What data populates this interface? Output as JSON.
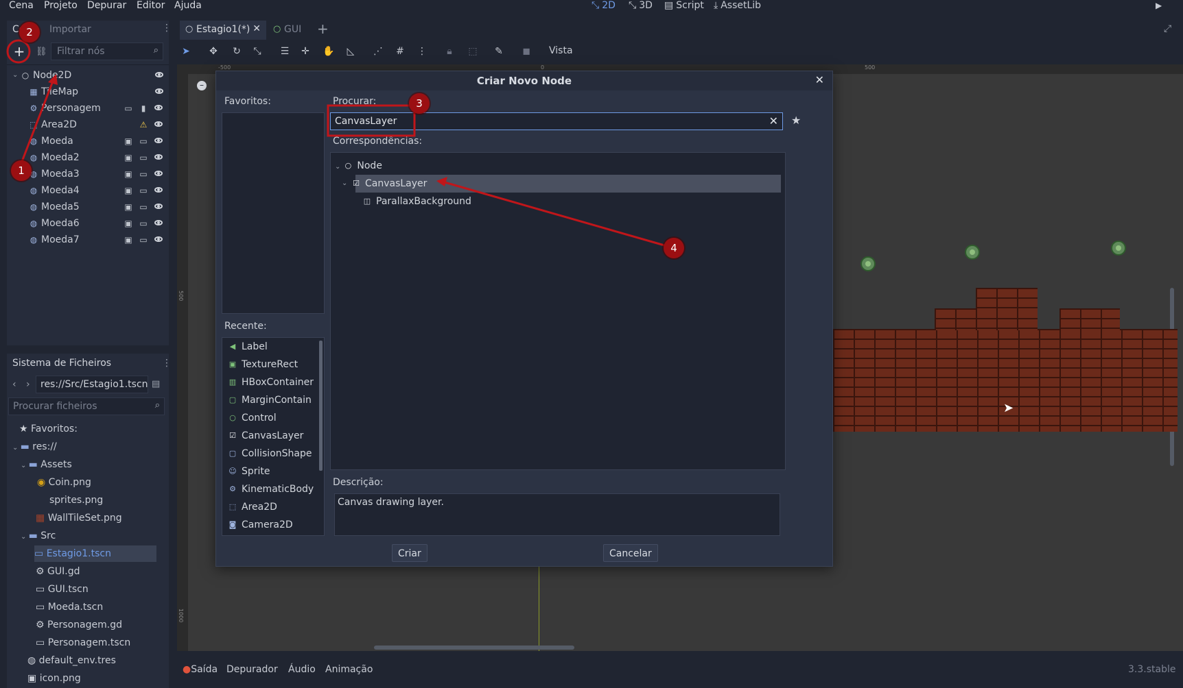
{
  "menubar": {
    "items": [
      "Cena",
      "Projeto",
      "Depurar",
      "Editor",
      "Ajuda"
    ],
    "modes": [
      "2D",
      "3D",
      "Script",
      "AssetLib"
    ]
  },
  "scene_dock": {
    "tabs": [
      "Cena",
      "Importar"
    ],
    "filter_placeholder": "Filtrar nós",
    "nodes": [
      {
        "name": "Node2D",
        "icon": "node2d-icon"
      },
      {
        "name": "TileMap",
        "icon": "tilemap-icon"
      },
      {
        "name": "Personagem",
        "icon": "kinematicbody-icon"
      },
      {
        "name": "Area2D",
        "icon": "area2d-icon"
      },
      {
        "name": "Moeda",
        "icon": "coin-node-icon"
      },
      {
        "name": "Moeda2",
        "icon": "coin-node-icon"
      },
      {
        "name": "Moeda3",
        "icon": "coin-node-icon"
      },
      {
        "name": "Moeda4",
        "icon": "coin-node-icon"
      },
      {
        "name": "Moeda5",
        "icon": "coin-node-icon"
      },
      {
        "name": "Moeda6",
        "icon": "coin-node-icon"
      },
      {
        "name": "Moeda7",
        "icon": "coin-node-icon"
      }
    ]
  },
  "filesystem": {
    "title": "Sistema de Ficheiros",
    "path": "res://Src/Estagio1.tscn",
    "search_placeholder": "Procurar ficheiros",
    "entries": [
      {
        "label": "Favoritos:"
      },
      {
        "label": "res://"
      },
      {
        "label": "Assets"
      },
      {
        "label": "Coin.png"
      },
      {
        "label": "sprites.png"
      },
      {
        "label": "WallTileSet.png"
      },
      {
        "label": "Src"
      },
      {
        "label": "Estagio1.tscn"
      },
      {
        "label": "GUI.gd"
      },
      {
        "label": "GUI.tscn"
      },
      {
        "label": "Moeda.tscn"
      },
      {
        "label": "Personagem.gd"
      },
      {
        "label": "Personagem.tscn"
      },
      {
        "label": "default_env.tres"
      },
      {
        "label": "icon.png"
      }
    ]
  },
  "editor_tabs": [
    "Estagio1(*)",
    "GUI"
  ],
  "toolbar": {
    "vista_label": "Vista"
  },
  "ruler": {
    "top_labels": [
      "-500",
      "0",
      "500"
    ],
    "left_labels": [
      "500",
      "1000"
    ]
  },
  "dialog": {
    "title": "Criar Novo Node",
    "favorites_label": "Favoritos:",
    "search_label": "Procurar:",
    "search_value": "CanvasLayer",
    "matches_label": "Correspondências:",
    "matches": [
      "Node",
      "CanvasLayer",
      "ParallaxBackground"
    ],
    "recent_label": "Recente:",
    "recent": [
      "Label",
      "TextureRect",
      "HBoxContainer",
      "MarginContain",
      "Control",
      "CanvasLayer",
      "CollisionShape",
      "Sprite",
      "KinematicBody",
      "Area2D",
      "Camera2D"
    ],
    "description_label": "Descrição:",
    "description": "Canvas drawing layer.",
    "create_label": "Criar",
    "cancel_label": "Cancelar"
  },
  "annotations": [
    "1",
    "2",
    "3",
    "4"
  ],
  "bottom": {
    "tabs": [
      "Saída",
      "Depurador",
      "Áudio",
      "Animação"
    ],
    "version": "3.3.stable"
  },
  "colors": {
    "accent": "#6f9be6",
    "annotation": "#9b0f12",
    "selected_row": "#4a5060"
  }
}
